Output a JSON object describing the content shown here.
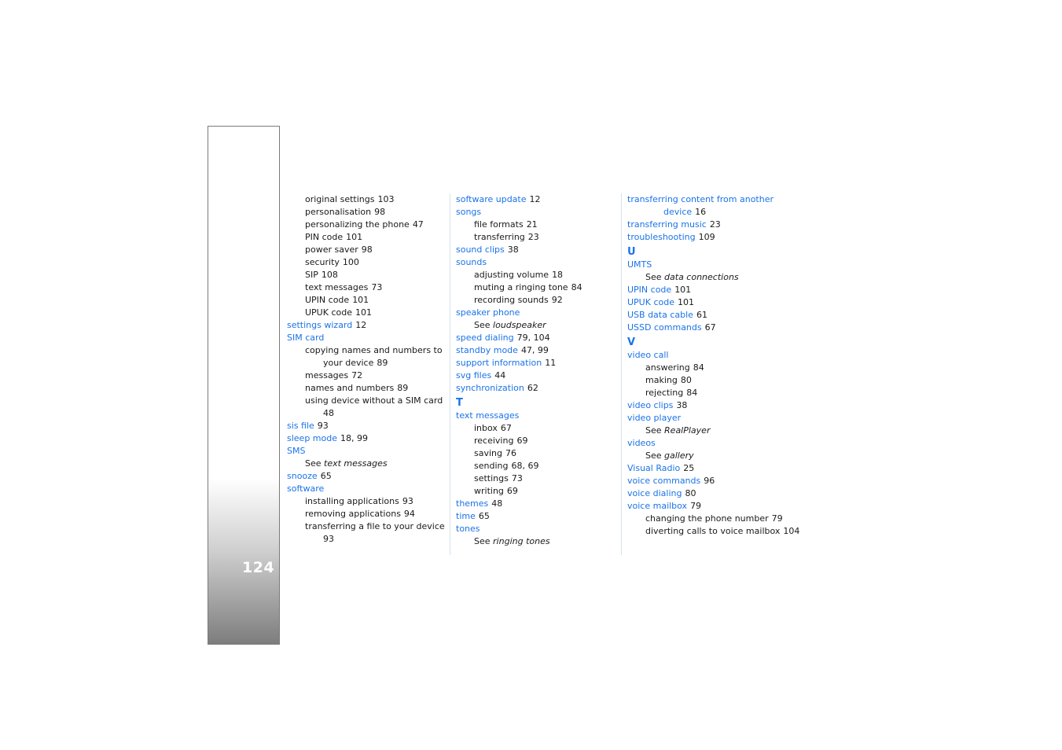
{
  "page_number": "124",
  "columns": [
    {
      "entries": [
        {
          "type": "sub",
          "text": "original settings",
          "pages": "103"
        },
        {
          "type": "sub",
          "text": "personalisation",
          "pages": "98"
        },
        {
          "type": "sub",
          "text": "personalizing the phone",
          "pages": "47"
        },
        {
          "type": "sub",
          "text": "PIN code",
          "pages": "101"
        },
        {
          "type": "sub",
          "text": "power saver",
          "pages": "98"
        },
        {
          "type": "sub",
          "text": "security",
          "pages": "100"
        },
        {
          "type": "sub",
          "text": "SIP",
          "pages": "108"
        },
        {
          "type": "sub",
          "text": "text messages",
          "pages": "73"
        },
        {
          "type": "sub",
          "text": "UPIN code",
          "pages": "101"
        },
        {
          "type": "sub",
          "text": "UPUK code",
          "pages": "101"
        },
        {
          "type": "term",
          "text": "settings wizard",
          "pages": "12"
        },
        {
          "type": "term",
          "text": "SIM card",
          "pages": ""
        },
        {
          "type": "sub",
          "text": "copying names and numbers to",
          "pages": ""
        },
        {
          "type": "cont",
          "text": "your device",
          "pages": "89"
        },
        {
          "type": "sub",
          "text": "messages",
          "pages": "72"
        },
        {
          "type": "sub",
          "text": "names and numbers",
          "pages": "89"
        },
        {
          "type": "sub",
          "text": "using device without a SIM card",
          "pages": ""
        },
        {
          "type": "cont",
          "text": "",
          "pages": "48"
        },
        {
          "type": "term",
          "text": "sis file",
          "pages": "93"
        },
        {
          "type": "term",
          "text": "sleep mode",
          "pages": "18, 99"
        },
        {
          "type": "term",
          "text": "SMS",
          "pages": ""
        },
        {
          "type": "see",
          "text": "See",
          "target": "text messages"
        },
        {
          "type": "term",
          "text": "snooze",
          "pages": "65"
        },
        {
          "type": "term",
          "text": "software",
          "pages": ""
        },
        {
          "type": "sub",
          "text": "installing applications",
          "pages": "93"
        },
        {
          "type": "sub",
          "text": "removing applications",
          "pages": "94"
        },
        {
          "type": "sub",
          "text": "transferring a file to your device",
          "pages": ""
        },
        {
          "type": "cont",
          "text": "",
          "pages": "93"
        }
      ]
    },
    {
      "entries": [
        {
          "type": "term",
          "text": "software update",
          "pages": "12"
        },
        {
          "type": "term",
          "text": "songs",
          "pages": ""
        },
        {
          "type": "sub",
          "text": "file formats",
          "pages": "21"
        },
        {
          "type": "sub",
          "text": "transferring",
          "pages": "23"
        },
        {
          "type": "term",
          "text": "sound clips",
          "pages": "38"
        },
        {
          "type": "term",
          "text": "sounds",
          "pages": ""
        },
        {
          "type": "sub",
          "text": "adjusting volume",
          "pages": "18"
        },
        {
          "type": "sub",
          "text": "muting a ringing tone",
          "pages": "84"
        },
        {
          "type": "sub",
          "text": "recording sounds",
          "pages": "92"
        },
        {
          "type": "term",
          "text": "speaker phone",
          "pages": ""
        },
        {
          "type": "see",
          "text": "See",
          "target": "loudspeaker"
        },
        {
          "type": "term",
          "text": "speed dialing",
          "pages": "79, 104"
        },
        {
          "type": "term",
          "text": "standby mode",
          "pages": "47, 99"
        },
        {
          "type": "term",
          "text": "support information",
          "pages": "11"
        },
        {
          "type": "term",
          "text": "svg files",
          "pages": "44"
        },
        {
          "type": "term",
          "text": "synchronization",
          "pages": "62"
        },
        {
          "type": "letter",
          "text": "T"
        },
        {
          "type": "term",
          "text": "text messages",
          "pages": ""
        },
        {
          "type": "sub",
          "text": "inbox",
          "pages": "67"
        },
        {
          "type": "sub",
          "text": "receiving",
          "pages": "69"
        },
        {
          "type": "sub",
          "text": "saving",
          "pages": "76"
        },
        {
          "type": "sub",
          "text": "sending",
          "pages": "68, 69"
        },
        {
          "type": "sub",
          "text": "settings",
          "pages": "73"
        },
        {
          "type": "sub",
          "text": "writing",
          "pages": "69"
        },
        {
          "type": "term",
          "text": "themes",
          "pages": "48"
        },
        {
          "type": "term",
          "text": "time",
          "pages": "65"
        },
        {
          "type": "term",
          "text": "tones",
          "pages": ""
        },
        {
          "type": "see",
          "text": "See",
          "target": "ringing tones"
        }
      ]
    },
    {
      "entries": [
        {
          "type": "term",
          "text": "transferring content from another",
          "pages": ""
        },
        {
          "type": "termcont",
          "text": "device",
          "pages": "16"
        },
        {
          "type": "term",
          "text": "transferring music",
          "pages": "23"
        },
        {
          "type": "term",
          "text": "troubleshooting",
          "pages": "109"
        },
        {
          "type": "letter",
          "text": "U"
        },
        {
          "type": "term",
          "text": "UMTS",
          "pages": ""
        },
        {
          "type": "see",
          "text": "See",
          "target": "data connections"
        },
        {
          "type": "term",
          "text": "UPIN code",
          "pages": "101"
        },
        {
          "type": "term",
          "text": "UPUK code",
          "pages": "101"
        },
        {
          "type": "term",
          "text": "USB data cable",
          "pages": "61"
        },
        {
          "type": "term",
          "text": "USSD commands",
          "pages": "67"
        },
        {
          "type": "letter",
          "text": "V"
        },
        {
          "type": "term",
          "text": "video call",
          "pages": ""
        },
        {
          "type": "sub",
          "text": "answering",
          "pages": "84"
        },
        {
          "type": "sub",
          "text": "making",
          "pages": "80"
        },
        {
          "type": "sub",
          "text": "rejecting",
          "pages": "84"
        },
        {
          "type": "term",
          "text": "video clips",
          "pages": "38"
        },
        {
          "type": "term",
          "text": "video player",
          "pages": ""
        },
        {
          "type": "see",
          "text": "See",
          "target": "RealPlayer"
        },
        {
          "type": "term",
          "text": "videos",
          "pages": ""
        },
        {
          "type": "see",
          "text": "See",
          "target": "gallery"
        },
        {
          "type": "term",
          "text": "Visual Radio",
          "pages": "25"
        },
        {
          "type": "term",
          "text": "voice commands",
          "pages": "96"
        },
        {
          "type": "term",
          "text": "voice dialing",
          "pages": "80"
        },
        {
          "type": "term",
          "text": "voice mailbox",
          "pages": "79"
        },
        {
          "type": "sub",
          "text": "changing the phone number",
          "pages": "79"
        },
        {
          "type": "sub",
          "text": "diverting calls to voice mailbox",
          "pages": "104"
        }
      ]
    }
  ]
}
